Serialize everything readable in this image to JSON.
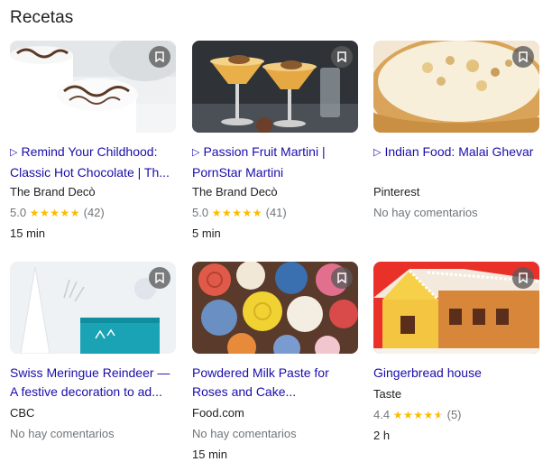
{
  "section_title": "Recetas",
  "colors": {
    "link": "#1a0dab",
    "star": "#fbbc04",
    "muted": "#70757a"
  },
  "bookmark_icon": "bookmark-icon",
  "cards": [
    {
      "title_prefix": "▷",
      "title": "Remind Your Childhood: Classic Hot Chocolate | Th...",
      "source": "The Brand Decò",
      "rating_value": "5.0",
      "stars": 5,
      "rating_count": "(42)",
      "time": "15 min"
    },
    {
      "title_prefix": "▷",
      "title": "Passion Fruit Martini | PornStar Martini",
      "source": "The Brand Decò",
      "rating_value": "5.0",
      "stars": 5,
      "rating_count": "(41)",
      "time": "5 min"
    },
    {
      "title_prefix": "▷",
      "title": "Indian Food: Malai Ghevar",
      "source": "Pinterest",
      "no_reviews": "No hay comentarios"
    },
    {
      "title": "Swiss Meringue Reindeer — A festive decoration to ad...",
      "source": "CBC",
      "no_reviews": "No hay comentarios"
    },
    {
      "title": "Powdered Milk Paste for Roses and Cake...",
      "source": "Food.com",
      "no_reviews": "No hay comentarios",
      "time": "15 min"
    },
    {
      "title": "Gingerbread house",
      "source": "Taste",
      "rating_value": "4.4",
      "stars": 4.5,
      "rating_count": "(5)",
      "time": "2 h"
    }
  ]
}
